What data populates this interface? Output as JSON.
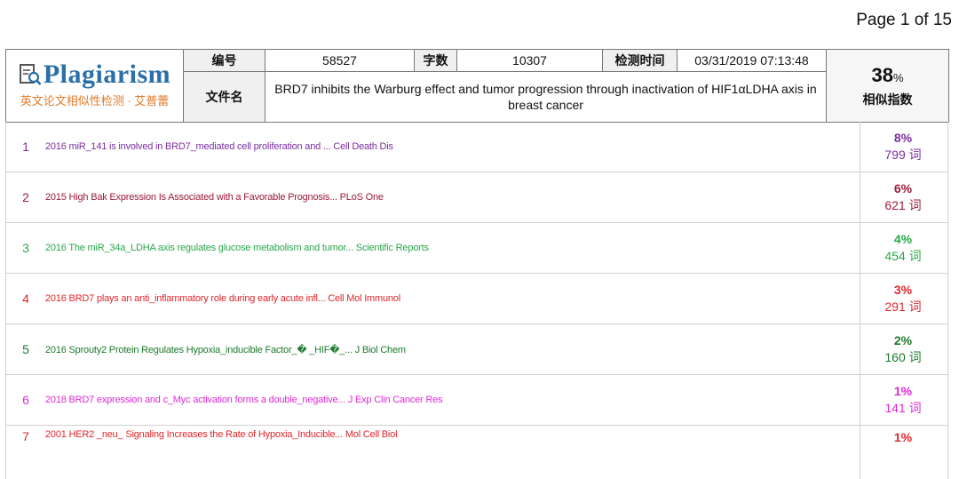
{
  "page_label": "Page 1 of 15",
  "logo": {
    "name": "Plagiarism",
    "tagline": "英文论文相似性检测 · 艾普蕾"
  },
  "header": {
    "id_label": "编号",
    "id_value": "58527",
    "words_label": "字数",
    "words_value": "10307",
    "time_label": "检测时间",
    "time_value": "03/31/2019 07:13:48",
    "file_label": "文件名",
    "file_title": "BRD7 inhibits the Warburg effect and tumor progression through inactivation of HIF1αLDHA axis in breast cancer",
    "score_value": "38",
    "score_unit": "%",
    "score_label": "相似指数"
  },
  "results": [
    {
      "num": "1",
      "title": "2016 miR_141 is involved in BRD7_mediated cell proliferation and ... Cell Death Dis",
      "pct": "8%",
      "words": "799 词",
      "color": "#7b2fa0"
    },
    {
      "num": "2",
      "title": "2015 High Bak Expression Is Associated with a Favorable Prognosis... PLoS One",
      "pct": "6%",
      "words": "621 词",
      "color": "#9b1b3a"
    },
    {
      "num": "3",
      "title": "2016 The miR_34a_LDHA axis regulates glucose metabolism and tumor... Scientific Reports",
      "pct": "4%",
      "words": "454 词",
      "color": "#2aa84a"
    },
    {
      "num": "4",
      "title": "2016 BRD7 plays an anti_inflammatory role during early acute infl... Cell Mol Immunol",
      "pct": "3%",
      "words": "291 词",
      "color": "#e0262b"
    },
    {
      "num": "5",
      "title": "2016 Sprouty2 Protein Regulates Hypoxia_inducible Factor_� _HIF�_... J Biol Chem",
      "pct": "2%",
      "words": "160 词",
      "color": "#1e7a2e"
    },
    {
      "num": "6",
      "title": "2018 BRD7 expression and c_Myc activation forms a double_negative... J Exp Clin Cancer Res",
      "pct": "1%",
      "words": "141 词",
      "color": "#e02ad8"
    },
    {
      "num": "7",
      "title": "2001 HER2 _neu_ Signaling Increases the Rate of Hypoxia_Inducible... Mol Cell Biol",
      "pct": "1%",
      "words": "",
      "color": "#e0262b"
    }
  ]
}
